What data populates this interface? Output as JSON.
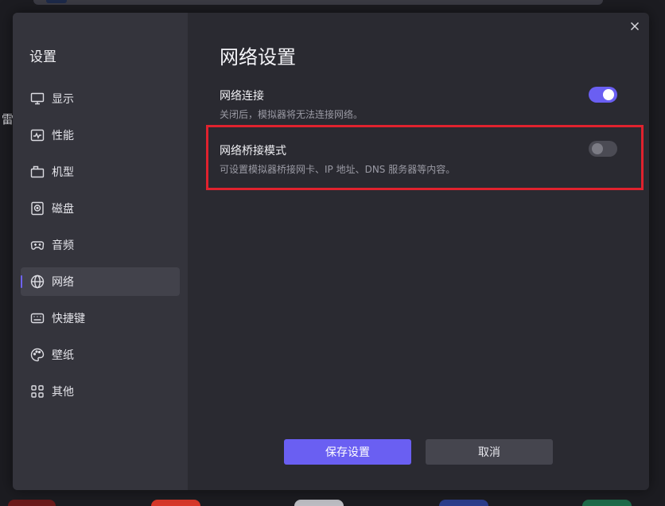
{
  "dialog": {
    "title": "网络设置",
    "sidebar": {
      "title": "设置",
      "items": [
        {
          "label": "显示",
          "icon": "monitor-icon"
        },
        {
          "label": "性能",
          "icon": "activity-icon"
        },
        {
          "label": "机型",
          "icon": "device-icon"
        },
        {
          "label": "磁盘",
          "icon": "disk-icon"
        },
        {
          "label": "音频",
          "icon": "gamepad-icon"
        },
        {
          "label": "网络",
          "icon": "globe-icon",
          "active": true
        },
        {
          "label": "快捷键",
          "icon": "keyboard-icon"
        },
        {
          "label": "壁纸",
          "icon": "palette-icon"
        },
        {
          "label": "其他",
          "icon": "grid-icon"
        }
      ]
    },
    "settings": [
      {
        "title": "网络连接",
        "description": "关闭后，模拟器将无法连接网络。",
        "enabled": true
      },
      {
        "title": "网络桥接模式",
        "description": "可设置模拟器桥接网卡、IP 地址、DNS 服务器等内容。",
        "enabled": false
      }
    ],
    "buttons": {
      "save": "保存设置",
      "cancel": "取消"
    }
  },
  "background": {
    "left_char": "雷"
  },
  "colors": {
    "accent": "#6a5ff2",
    "highlight": "#e0222e",
    "dialog_bg": "#2a2a31",
    "sidebar_bg": "#34343c"
  }
}
